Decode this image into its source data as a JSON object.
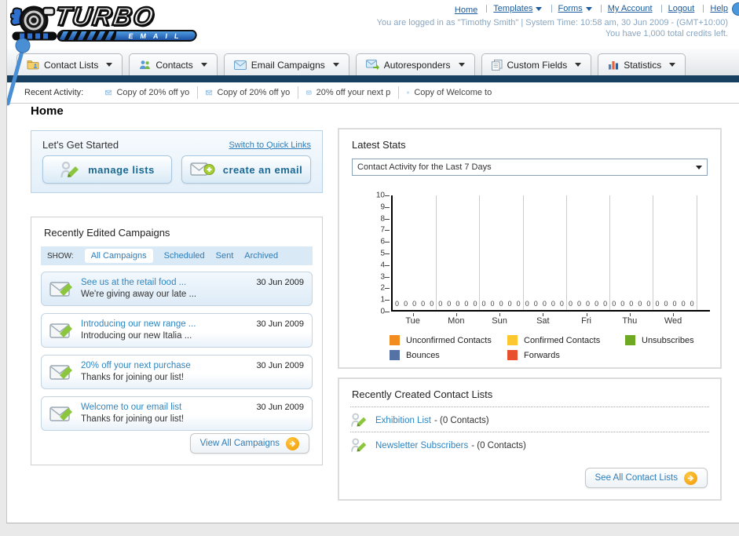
{
  "brand": {
    "name_top": "TURBO",
    "name_bottom": "EMAIL"
  },
  "header": {
    "links": [
      {
        "label": "Home",
        "dropdown": false
      },
      {
        "label": "Templates",
        "dropdown": true
      },
      {
        "label": "Forms",
        "dropdown": true
      },
      {
        "label": "My Account",
        "dropdown": false
      },
      {
        "label": "Logout",
        "dropdown": false
      },
      {
        "label": "Help",
        "dropdown": false
      }
    ],
    "login_line": "You are logged in as \"Timothy Smith\" | System Time: 10:58 am, 30 Jun 2009 - (GMT+10:00)",
    "credits_line": "You have 1,000 total credits left."
  },
  "nav": {
    "tabs": [
      {
        "label": "Contact Lists",
        "icon": "contact-lists-icon"
      },
      {
        "label": "Contacts",
        "icon": "contacts-icon"
      },
      {
        "label": "Email Campaigns",
        "icon": "email-campaigns-icon"
      },
      {
        "label": "Autoresponders",
        "icon": "autoresponders-icon"
      },
      {
        "label": "Custom Fields",
        "icon": "custom-fields-icon"
      },
      {
        "label": "Statistics",
        "icon": "statistics-icon"
      }
    ]
  },
  "recent_activity": {
    "label": "Recent Activity:",
    "items": [
      "Copy of 20% off yo",
      "Copy of 20% off yo",
      "20% off your next p",
      "Copy of Welcome to"
    ]
  },
  "page_title": "Home",
  "get_started": {
    "title": "Let's Get Started",
    "switch_link": "Switch to Quick Links",
    "manage_label": "manage lists",
    "create_label": "create an email"
  },
  "campaigns": {
    "title": "Recently Edited Campaigns",
    "show_label": "SHOW:",
    "filters": [
      "All Campaigns",
      "Scheduled",
      "Sent",
      "Archived"
    ],
    "active_filter": "All Campaigns",
    "items": [
      {
        "title": "See us at the retail food ...",
        "subtitle": "We're giving away our late ...",
        "date": "30 Jun 2009"
      },
      {
        "title": "Introducing our new range ...",
        "subtitle": "Introducing our new Italia ...",
        "date": "30 Jun 2009"
      },
      {
        "title": "20% off your next purchase",
        "subtitle": "Thanks for joining our list!",
        "date": "30 Jun 2009"
      },
      {
        "title": "Welcome to our email list",
        "subtitle": "Thanks for joining our list!",
        "date": "30 Jun 2009"
      }
    ],
    "view_all_label": "View All Campaigns"
  },
  "latest_stats": {
    "title": "Latest Stats",
    "dropdown_value": "Contact Activity for the Last 7 Days"
  },
  "chart_data": {
    "type": "bar",
    "title": "Contact Activity for the Last 7 Days",
    "categories": [
      "Tue",
      "Mon",
      "Sun",
      "Sat",
      "Fri",
      "Thu",
      "Wed"
    ],
    "series": [
      {
        "name": "Unconfirmed Contacts",
        "color": "#f28c1e",
        "values": [
          0,
          0,
          0,
          0,
          0,
          0,
          0
        ]
      },
      {
        "name": "Confirmed Contacts",
        "color": "#fdc730",
        "values": [
          0,
          0,
          0,
          0,
          0,
          0,
          0
        ]
      },
      {
        "name": "Unsubscribes",
        "color": "#6fa822",
        "values": [
          0,
          0,
          0,
          0,
          0,
          0,
          0
        ]
      },
      {
        "name": "Bounces",
        "color": "#5572a7",
        "values": [
          0,
          0,
          0,
          0,
          0,
          0,
          0
        ]
      },
      {
        "name": "Forwards",
        "color": "#e8502d",
        "values": [
          0,
          0,
          0,
          0,
          0,
          0,
          0
        ]
      }
    ],
    "ylim": [
      0,
      10
    ],
    "yticks": [
      0,
      1,
      2,
      3,
      4,
      5,
      6,
      7,
      8,
      9,
      10
    ],
    "grid": true,
    "legend_position": "bottom"
  },
  "contact_lists": {
    "title": "Recently Created Contact Lists",
    "items": [
      {
        "name": "Exhibition List",
        "detail": "- (0 Contacts)"
      },
      {
        "name": "Newsletter Subscribers",
        "detail": "- (0 Contacts)"
      }
    ],
    "see_all_label": "See All Contact Lists"
  },
  "colors": {
    "navy_bar": "#173f5f",
    "link_blue": "#1a5a9c",
    "teal_link": "#2e86c1",
    "orange_arrow": "#f0a006",
    "pin_blue": "#4a8fd4"
  },
  "icons": [
    "turbo-icon",
    "envelope-icon",
    "pencil-icon",
    "person-icon",
    "plus-icon",
    "arrow-icon",
    "folder-icon",
    "people-icon",
    "pages-icon",
    "bar-chart-icon",
    "dropdown-arrow-icon",
    "pin-icon",
    "help-dot-icon"
  ]
}
